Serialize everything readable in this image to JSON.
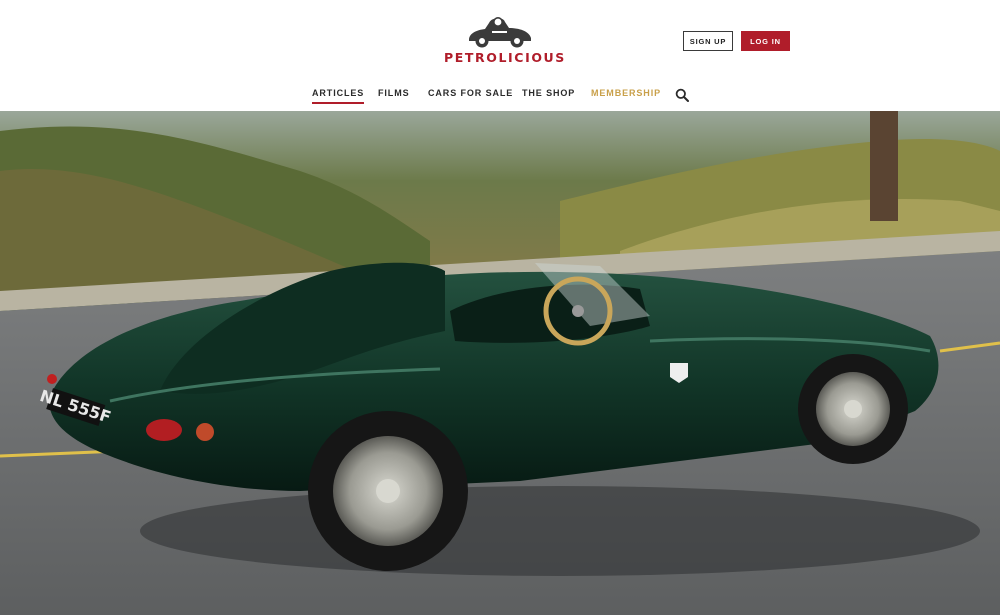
{
  "brand": {
    "name": "PETROLICIOUS",
    "color": "#b01d2a"
  },
  "auth": {
    "signup_label": "SIGN UP",
    "login_label": "LOG IN"
  },
  "nav": {
    "items": [
      {
        "label": "ARTICLES",
        "active": true
      },
      {
        "label": "FILMS"
      },
      {
        "label": "CARS FOR SALE"
      },
      {
        "label": "THE SHOP"
      },
      {
        "label": "MEMBERSHIP",
        "color": "#c9a04a"
      }
    ],
    "search_icon": "search-icon"
  },
  "hero": {
    "plate": "NL 555F"
  }
}
